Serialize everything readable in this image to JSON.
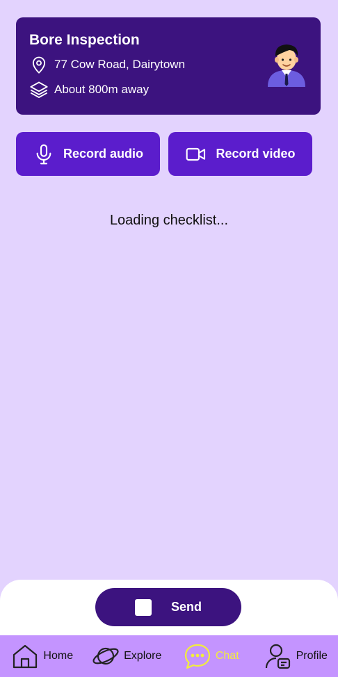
{
  "job": {
    "title": "Bore Inspection",
    "address": "77 Cow Road, Dairytown",
    "distance": "About 800m away",
    "icons": [
      "location-pin-icon",
      "layers-icon",
      "avatar-icon"
    ]
  },
  "actions": {
    "record_audio": "Record audio",
    "record_video": "Record video",
    "icons": [
      "microphone-icon",
      "video-camera-icon"
    ]
  },
  "status": {
    "loading": "Loading checklist..."
  },
  "send": {
    "label": "Send"
  },
  "nav": {
    "items": [
      {
        "label": "Home",
        "icon": "home-icon"
      },
      {
        "label": "Explore",
        "icon": "planet-icon"
      },
      {
        "label": "Chat",
        "icon": "chat-bubble-icon",
        "active": true
      },
      {
        "label": "Profile",
        "icon": "profile-icon"
      }
    ]
  },
  "colors": {
    "background": "#e3d3fe",
    "card": "#3c137f",
    "button": "#5b1dcc",
    "nav": "#c494ff",
    "active_nav": "#f2ee3b"
  }
}
